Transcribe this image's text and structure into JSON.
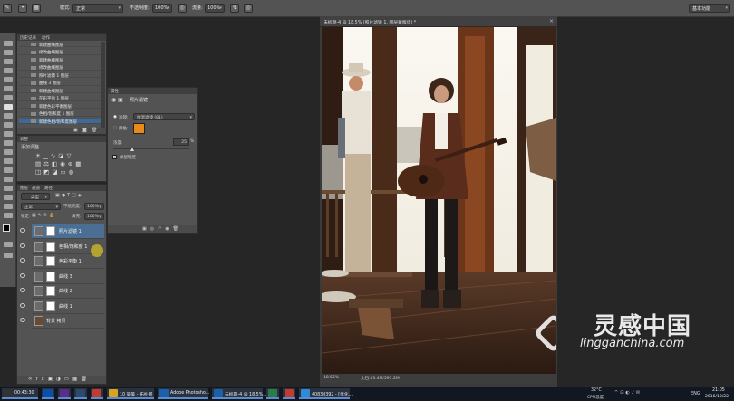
{
  "options_bar": {
    "mode_label": "模式:",
    "mode_value": "正常",
    "opacity_label": "不透明度:",
    "opacity_value": "100%",
    "flow_label": "流量:",
    "flow_value": "100%",
    "workspace": "基本功能"
  },
  "document": {
    "tab_title": "未标题-4 @ 18.5% (照片滤镜 1, 图层蒙版/8) *",
    "zoom": "18.55%",
    "doc_info": "文档:63.4M/595.2M"
  },
  "history_panel": {
    "tabs": [
      "历史记录",
      "动作"
    ],
    "items": [
      "新建曲线图层",
      "修改曲线图层",
      "新建曲线图层",
      "修改曲线图层",
      "照片滤镜 1 图层",
      "曲线 3 图层",
      "新建曲线图层",
      "在彩平衡 1 图层",
      "新建色彩平衡图层",
      "色相/饱和度 1 图层",
      "新建色相/饱和度图层"
    ]
  },
  "adjustments_panel": {
    "tabs": [
      "调整"
    ],
    "title": "添加调整"
  },
  "layers_panel": {
    "tabs": [
      "图层",
      "通道",
      "路径"
    ],
    "kind_filter": "类型",
    "blend_mode": "正常",
    "opacity_label": "不透明度:",
    "opacity_value": "100%",
    "lock_label": "锁定:",
    "fill_label": "填充:",
    "fill_value": "100%",
    "layers": [
      {
        "name": "照片滤镜 1",
        "selected": true
      },
      {
        "name": "色相/饱和度 1",
        "selected": false
      },
      {
        "name": "色彩平衡 1",
        "selected": false
      },
      {
        "name": "曲线 3",
        "selected": false
      },
      {
        "name": "曲线 2",
        "selected": false
      },
      {
        "name": "曲线 1",
        "selected": false
      },
      {
        "name": "背景 拷贝",
        "selected": false
      }
    ]
  },
  "properties_panel": {
    "title": "属性",
    "subtitle": "照片滤镜",
    "filter_label": "滤镜:",
    "filter_value": "加温滤镜 (81)",
    "color_label": "颜色:",
    "density_label": "浓度:",
    "density_value": "25",
    "density_unit": "%",
    "preserve_label": "保留明度",
    "preserve_checked": true,
    "color_swatch": "#e8891a"
  },
  "watermark": {
    "cn": "灵感中国",
    "url": "lingganchina.com"
  },
  "taskbar": {
    "items": [
      {
        "label": "00:43:30",
        "color": "#333"
      },
      {
        "label": "",
        "color": "#0a4fa8"
      },
      {
        "label": "",
        "color": "#5a2d8a"
      },
      {
        "label": "",
        "color": "#2c4a6b"
      },
      {
        "label": "",
        "color": "#c23b2e"
      },
      {
        "label": "10 調美 - 拓扑图",
        "color": "#d8a321"
      },
      {
        "label": "Adobe Photosho...",
        "color": "#1d5fa8"
      },
      {
        "label": "未标题-4 @ 18.5%...",
        "color": "#1d5fa8"
      },
      {
        "label": "",
        "color": "#2a7d4b"
      },
      {
        "label": "",
        "color": "#c23b2e"
      },
      {
        "label": "40830392 - [优化...",
        "color": "#2f8bd6"
      }
    ],
    "weather": "32°C",
    "weather_sub": "CPU温度",
    "ime": "ENG",
    "time": "21:05",
    "date": "2016/10/22"
  }
}
